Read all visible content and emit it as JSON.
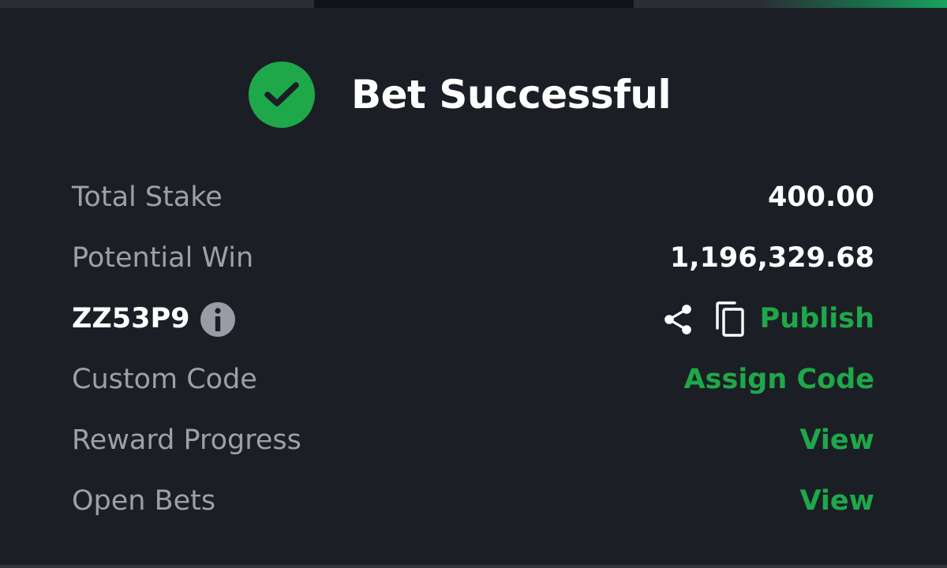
{
  "colors": {
    "accent": "#1ea84a",
    "background": "#1c1e25",
    "label": "#9ea0a8",
    "value": "#ffffff"
  },
  "header": {
    "title": "Bet Successful",
    "icon": "check-circle-icon"
  },
  "summary": {
    "total_stake_label": "Total Stake",
    "total_stake_value": "400.00",
    "potential_win_label": "Potential Win",
    "potential_win_value": "1,196,329.68"
  },
  "booking": {
    "code": "ZZ53P9",
    "info_icon": "info-icon",
    "share_icon": "share-icon",
    "copy_icon": "copy-icon",
    "publish_label": "Publish"
  },
  "custom_code": {
    "label": "Custom Code",
    "action_label": "Assign Code"
  },
  "reward_progress": {
    "label": "Reward Progress",
    "action_label": "View"
  },
  "open_bets": {
    "label": "Open Bets",
    "action_label": "View"
  }
}
